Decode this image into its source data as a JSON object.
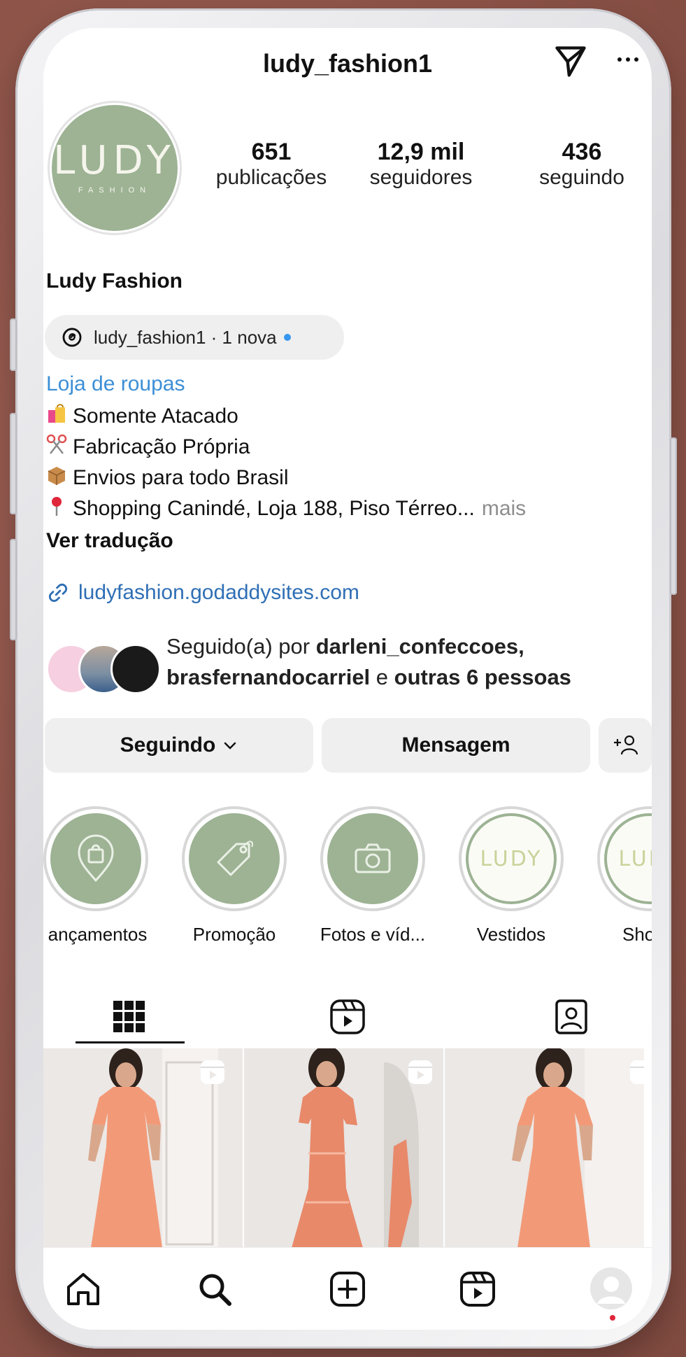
{
  "profile": {
    "username": "ludy_fashion1",
    "avatar_logo": "LUDY",
    "avatar_sub": "FASHION",
    "name": "Ludy Fashion"
  },
  "stats": [
    {
      "value": "651",
      "label": "publicações"
    },
    {
      "value": "12,9 mil",
      "label": "seguidores"
    },
    {
      "value": "436",
      "label": "seguindo"
    }
  ],
  "threads": {
    "text": "ludy_fashion1 · 1 nova"
  },
  "bio": {
    "category": "Loja de roupas",
    "lines": [
      {
        "icon": "shopping-bags-icon",
        "text": "Somente Atacado"
      },
      {
        "icon": "scissors-icon",
        "text": "Fabricação Própria"
      },
      {
        "icon": "package-icon",
        "text": "Envios para todo Brasil"
      },
      {
        "icon": "pin-icon",
        "text": "Shopping Canindé, Loja 188, Piso Térreo..."
      }
    ],
    "more": "mais",
    "translate": "Ver tradução",
    "link": "ludyfashion.godaddysites.com"
  },
  "followed_by": {
    "prefix": "Seguido(a) por ",
    "user1": "darleni_confeccoes,",
    "user2": "brasfernandocarriel",
    "middle": " e ",
    "others": "outras 6 pessoas"
  },
  "actions": {
    "following": "Seguindo",
    "message": "Mensagem"
  },
  "highlights": [
    {
      "label": "ançamentos",
      "icon": "shopping-bag-pin-icon"
    },
    {
      "label": "Promoção",
      "icon": "tag-icon"
    },
    {
      "label": "Fotos e víd...",
      "icon": "camera-icon"
    },
    {
      "label": "Vestidos",
      "icon": "ludy-logo"
    },
    {
      "label": "Sho",
      "icon": "ludy-logo"
    }
  ],
  "highlight_logo_text": "LUDY",
  "colors": {
    "brand_green": "#9db394",
    "link_blue": "#2f6fb5",
    "category_blue": "#3d8fd6",
    "dress_coral": "#f29a78",
    "notification_red": "#e0263a"
  }
}
